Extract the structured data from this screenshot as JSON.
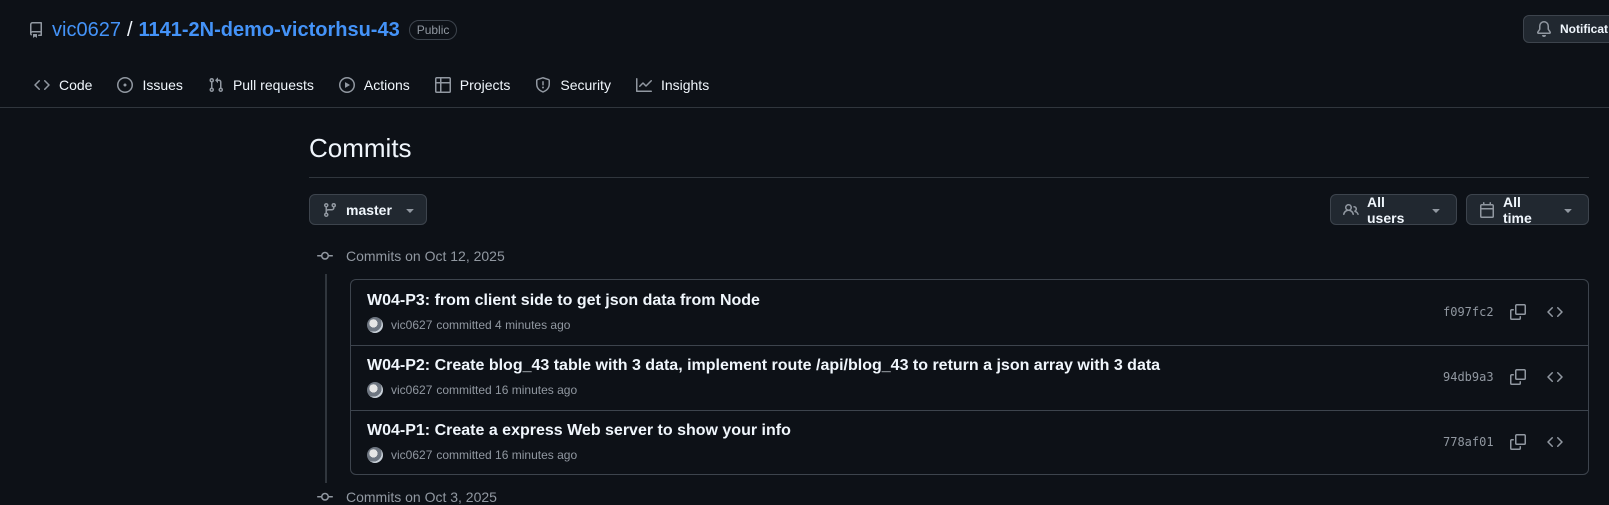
{
  "repo": {
    "owner": "vic0627",
    "separator": "/",
    "name": "1141-2N-demo-victorhsu-43",
    "visibility": "Public"
  },
  "header": {
    "notifications_label": "Notificat"
  },
  "nav": {
    "tabs": [
      {
        "label": "Code",
        "icon": "code-icon"
      },
      {
        "label": "Issues",
        "icon": "issue-opened-icon"
      },
      {
        "label": "Pull requests",
        "icon": "git-pull-request-icon"
      },
      {
        "label": "Actions",
        "icon": "play-icon"
      },
      {
        "label": "Projects",
        "icon": "table-icon"
      },
      {
        "label": "Security",
        "icon": "shield-icon"
      },
      {
        "label": "Insights",
        "icon": "graph-icon"
      }
    ]
  },
  "page": {
    "title": "Commits",
    "branch_label": "master",
    "users_filter_label": "All users",
    "time_filter_label": "All time"
  },
  "groups": [
    {
      "header": "Commits on Oct 12, 2025",
      "commits": [
        {
          "message": "W04-P3: from client side to get json data from Node",
          "author": "vic0627",
          "committed_text": "committed 4 minutes ago",
          "sha": "f097fc2"
        },
        {
          "message": "W04-P2: Create blog_43 table with 3 data, implement route /api/blog_43 to return a json array with 3 data",
          "author": "vic0627",
          "committed_text": "committed 16 minutes ago",
          "sha": "94db9a3"
        },
        {
          "message": "W04-P1: Create a express Web server to show your info",
          "author": "vic0627",
          "committed_text": "committed 16 minutes ago",
          "sha": "778af01"
        }
      ]
    },
    {
      "header": "Commits on Oct 3, 2025",
      "commits": []
    }
  ],
  "colors": {
    "background": "#0d1117",
    "link": "#4493f8",
    "muted": "#9198a1",
    "border": "#3d444d"
  }
}
